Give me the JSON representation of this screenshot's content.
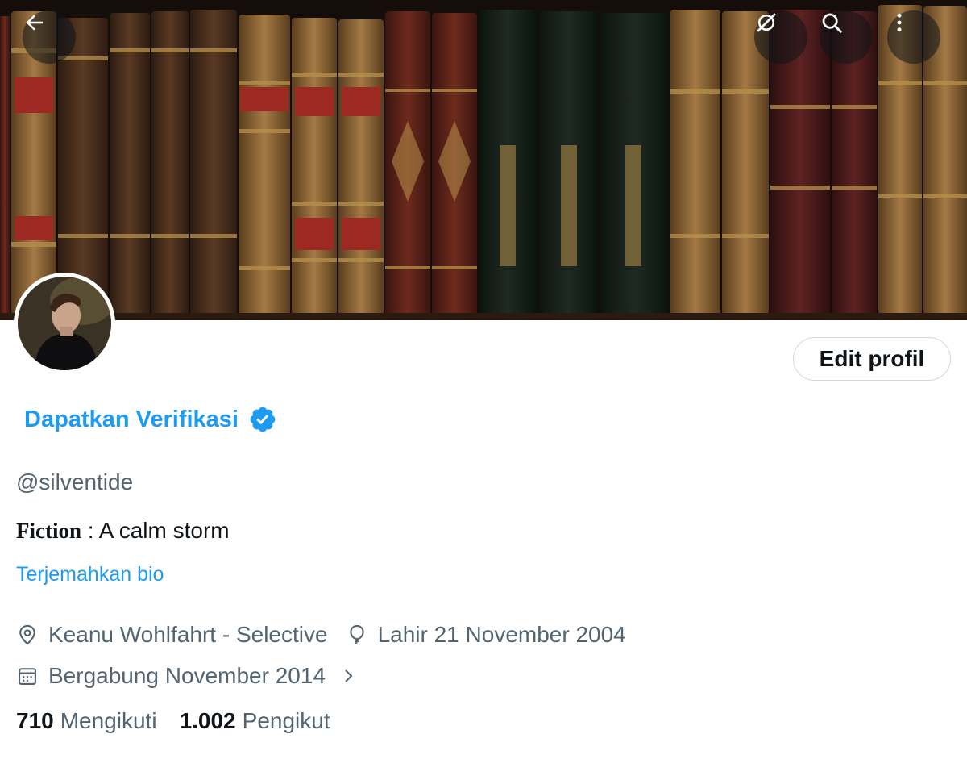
{
  "header": {
    "icons": [
      "back-arrow-icon",
      "grok-icon",
      "search-icon",
      "more-vertical-icon"
    ]
  },
  "profile": {
    "edit_button": "Edit profil",
    "display_name": "Dapatkan Verifikasi",
    "handle": "@silventide",
    "bio_label": "Fiction",
    "bio_separator": " : ",
    "bio_text": "A calm storm",
    "translate_bio": "Terjemahkan bio",
    "location": "Keanu Wohlfahrt - Selective",
    "birthday": "Lahir 21 November 2004",
    "joined": "Bergabung November 2014",
    "following_count": "710",
    "following_label": "Mengikuti",
    "followers_count": "1.002",
    "followers_label": "Pengikut"
  },
  "colors": {
    "accent": "#1d9bf0",
    "secondary_text": "#536471",
    "primary_text": "#0f1419",
    "border": "#cfd9de"
  }
}
